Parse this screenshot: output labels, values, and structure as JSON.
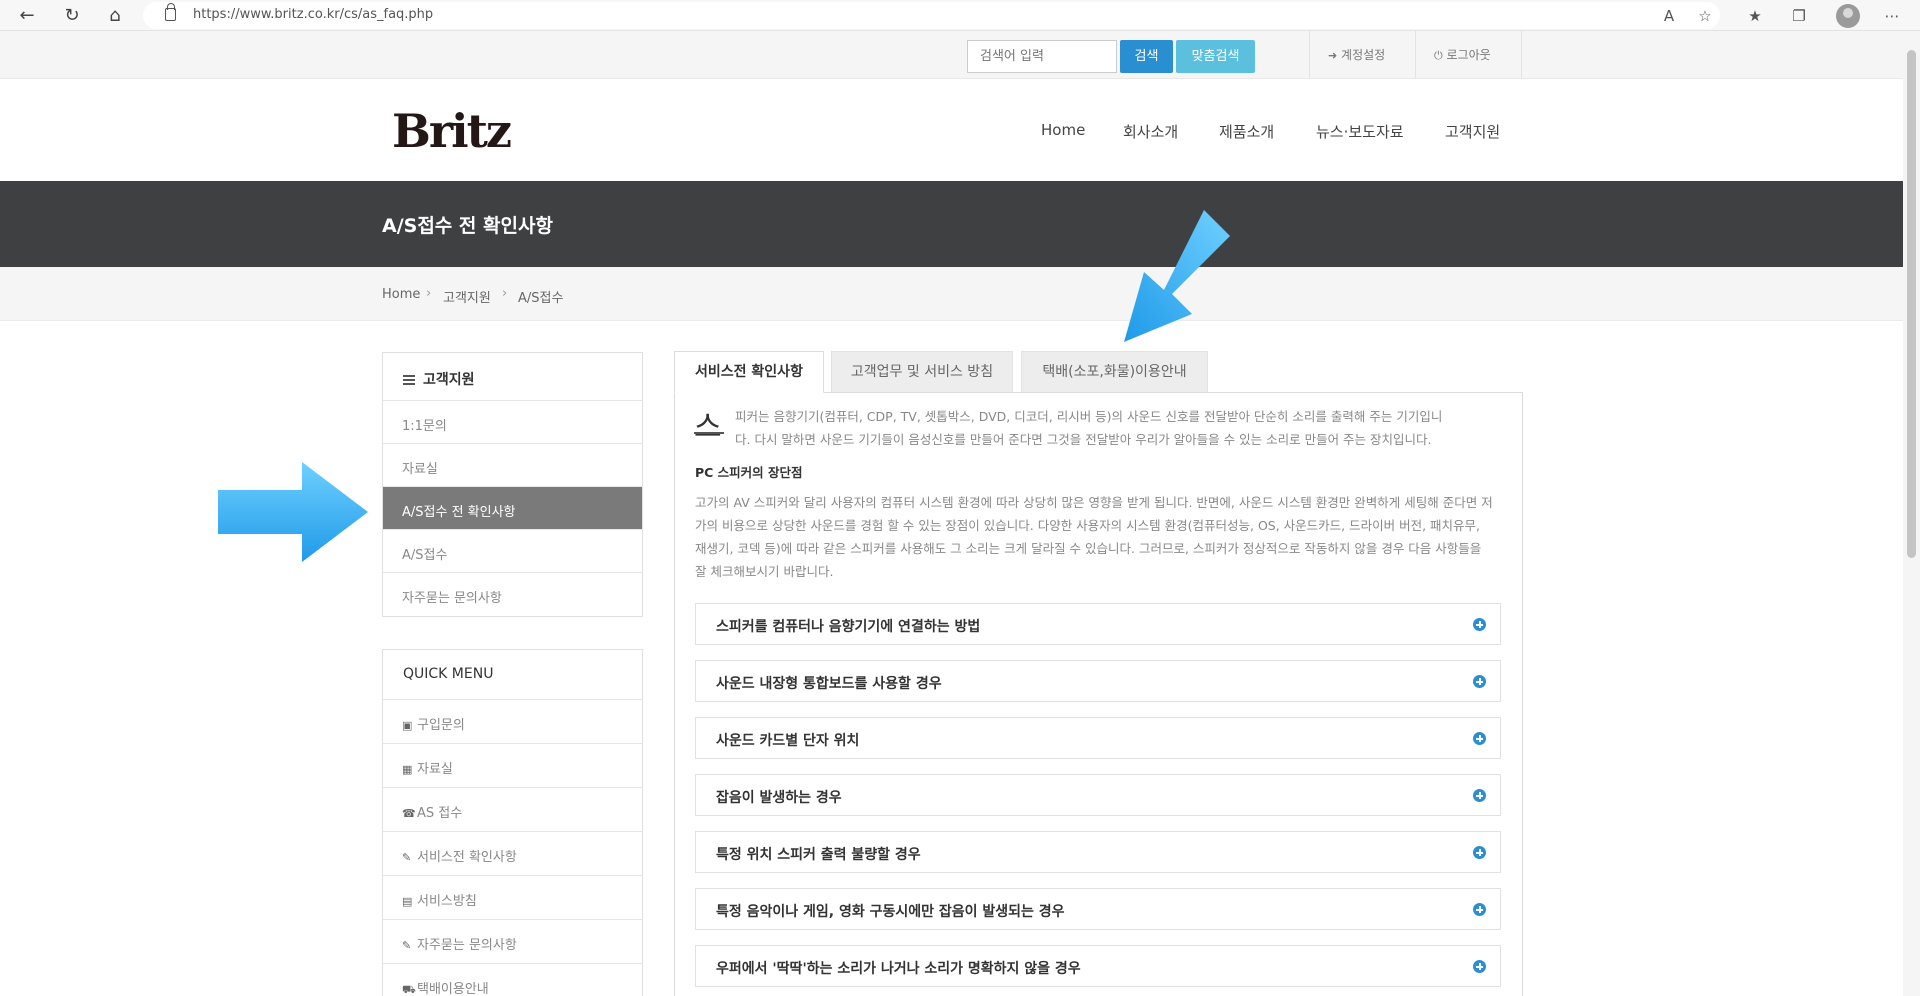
{
  "browser": {
    "url": "https://www.britz.co.kr/cs/as_faq.php"
  },
  "util": {
    "search_placeholder": "검색어 입력",
    "search_button": "검색",
    "custom_search_button": "맞춤검색",
    "account_settings": "계정설정",
    "logout": "로그아웃"
  },
  "header": {
    "logo": "Britz",
    "nav": [
      "Home",
      "회사소개",
      "제품소개",
      "뉴스·보도자료",
      "고객지원"
    ]
  },
  "banner": {
    "title": "A/S접수 전 확인사항"
  },
  "breadcrumb": [
    "Home",
    "고객지원",
    "A/S접수"
  ],
  "sidebar": {
    "heading": "고객지원",
    "items": [
      "1:1문의",
      "자료실",
      "A/S접수 전 확인사항",
      "A/S접수",
      "자주묻는 문의사항"
    ],
    "active_index": 2
  },
  "quick_menu": {
    "heading": "QUICK MENU",
    "items": [
      {
        "icon": "cart-icon",
        "label": "구입문의"
      },
      {
        "icon": "save-icon",
        "label": "자료실"
      },
      {
        "icon": "phone-icon",
        "label": "AS 접수"
      },
      {
        "icon": "edit-icon",
        "label": "서비스전 확인사항"
      },
      {
        "icon": "document-icon",
        "label": "서비스방침"
      },
      {
        "icon": "edit-icon",
        "label": "자주묻는 문의사항"
      },
      {
        "icon": "truck-icon",
        "label": "택배이용안내"
      }
    ]
  },
  "tabs": [
    "서비스전 확인사항",
    "고객업무 및 서비스 방침",
    "택배(소포,화물)이용안내"
  ],
  "content": {
    "dropcap": "스",
    "intro_line1": "피커는 음향기기(컴퓨터, CDP, TV, 셋톱박스, DVD, 디코더, 리시버 등)의 사운드 신호를 전달받아 단순히 소리를 출력해 주는 기기입니",
    "intro_line2": "다. 다시 말하면 사운드 기기들이 음성신호를 만들어 준다면 그것을 전달받아 우리가 알아들을 수 있는 소리로 만들어 주는 장치입니다.",
    "sub_heading": "PC 스피커의 장단점",
    "body": "고가의 AV 스피커와 달리 사용자의 컴퓨터 시스템 환경에 따라 상당히 많은 영향을 받게 됩니다. 반면에, 사운드 시스템 환경만 완벽하게 세팅해 준다면 저가의 비용으로 상당한 사운드를 경험 할 수 있는 장점이 있습니다. 다양한 사용자의 시스템 환경(컴퓨터성능, OS, 사운드카드, 드라이버 버전, 패치유무, 재생기, 코덱 등)에 따라 같은 스피커를 사용해도 그 소리는 크게 달라질 수 있습니다. 그러므로, 스피커가 정상적으로 작동하지 않을 경우 다음 사항들을 잘 체크해보시기 바랍니다."
  },
  "faq": [
    "스피커를 컴퓨터나 음향기기에 연결하는 방법",
    "사운드 내장형 통합보드를 사용할 경우",
    "사운드 카드별 단자 위치",
    "잡음이 발생하는 경우",
    "특정 위치 스피커 출력 불량할 경우",
    "특정 음악이나 게임, 영화 구동시에만 잡음이 발생되는 경우",
    "우퍼에서 '딱딱'하는 소리가 나거나 소리가 명확하지 않을 경우"
  ],
  "colors": {
    "banner": "#3f4042",
    "primary_blue": "#2a8fd0",
    "light_blue": "#5bc0de",
    "arrow_blue": "#29a8f0",
    "active_side": "#7a7a7a"
  }
}
